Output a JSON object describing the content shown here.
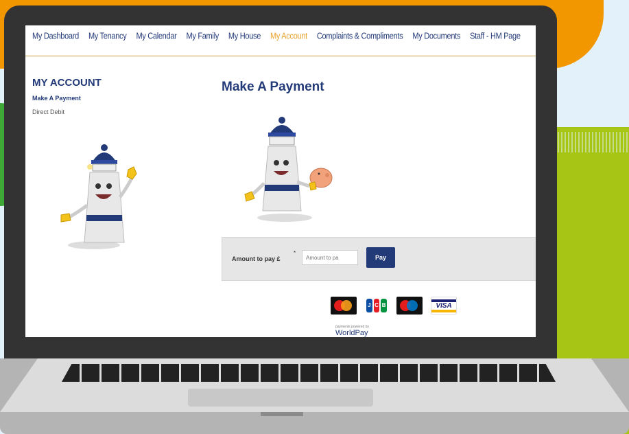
{
  "nav": {
    "items": [
      {
        "label": "My Dashboard",
        "active": false
      },
      {
        "label": "My Tenancy",
        "active": false
      },
      {
        "label": "My Calendar",
        "active": false
      },
      {
        "label": "My Family",
        "active": false
      },
      {
        "label": "My House",
        "active": false
      },
      {
        "label": "My Account",
        "active": true
      },
      {
        "label": "Complaints & Compliments",
        "active": false
      },
      {
        "label": "My Documents",
        "active": false
      },
      {
        "label": "Staff - HM Page",
        "active": false
      }
    ],
    "active_color": "#e8a32b",
    "text_color": "#233a79"
  },
  "sidebar": {
    "title": "MY ACCOUNT",
    "items": [
      {
        "label": "Make A Payment",
        "active": true
      },
      {
        "label": "Direct Debit",
        "active": false
      }
    ]
  },
  "main": {
    "title": "Make A Payment",
    "payment": {
      "amount_label": "Amount to pay £",
      "required_marker": "*",
      "amount_placeholder": "Amount to pa",
      "pay_label": "Pay"
    },
    "card_icons": [
      "mastercard-icon",
      "jcb-icon",
      "maestro-icon",
      "visa-icon"
    ],
    "jcb_letters": [
      "J",
      "C",
      "B"
    ],
    "visa_label": "VISA",
    "provider": {
      "caption": "payments powered by",
      "name": "WorldPay"
    }
  },
  "colors": {
    "brand_navy": "#233a79",
    "accent_orange": "#f29700",
    "grass_green": "#a6c515"
  }
}
